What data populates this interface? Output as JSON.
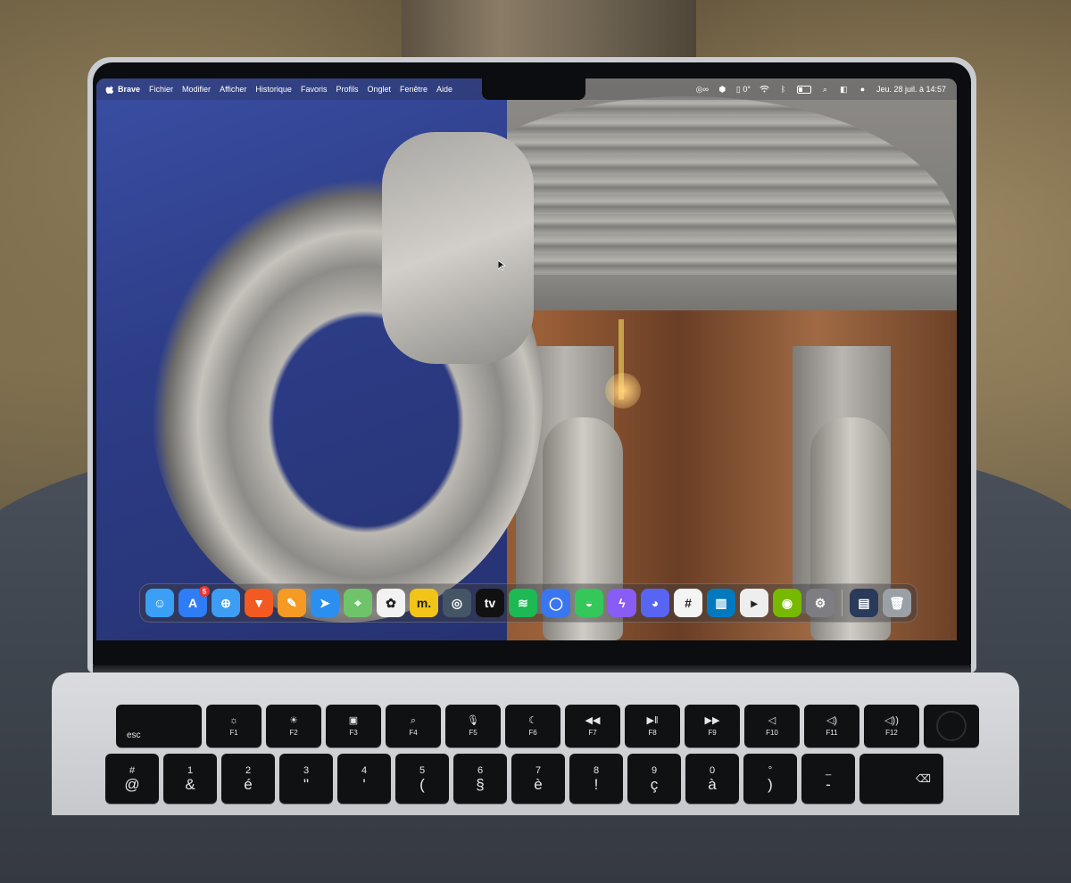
{
  "menubar": {
    "app_name": "Brave",
    "items": [
      "Fichier",
      "Modifier",
      "Afficher",
      "Historique",
      "Favoris",
      "Profils",
      "Onglet",
      "Fenêtre",
      "Aide"
    ],
    "status": {
      "vpn_text": "∞",
      "temp_text": "0°",
      "datetime": "Jeu. 28 juil. à 14:57"
    }
  },
  "dock": {
    "appstore_badge": "5",
    "apps": [
      {
        "name": "finder-icon",
        "glyph": "☺",
        "color": "#3aa0f5"
      },
      {
        "name": "app-store-icon",
        "glyph": "A",
        "color": "#2f7df6"
      },
      {
        "name": "safari-icon",
        "glyph": "⊕",
        "color": "#3d9df2"
      },
      {
        "name": "brave-icon",
        "glyph": "▼",
        "color": "#f25a22"
      },
      {
        "name": "pages-icon",
        "glyph": "✎",
        "color": "#f59a23"
      },
      {
        "name": "spark-icon",
        "glyph": "➤",
        "color": "#2b8ff0"
      },
      {
        "name": "maps-icon",
        "glyph": "⌖",
        "color": "#6fc46a"
      },
      {
        "name": "photos-icon",
        "glyph": "✿",
        "color": "#f2f2f2"
      },
      {
        "name": "metaview-icon",
        "glyph": "m.",
        "color": "#f2c418"
      },
      {
        "name": "quicktime-icon",
        "glyph": "◎",
        "color": "#445566"
      },
      {
        "name": "apple-tv-icon",
        "glyph": "tv",
        "color": "#111111"
      },
      {
        "name": "spotify-icon",
        "glyph": "≋",
        "color": "#1db954"
      },
      {
        "name": "signal-icon",
        "glyph": "◯",
        "color": "#3a76f0"
      },
      {
        "name": "messages-icon",
        "glyph": "◒",
        "color": "#34c759"
      },
      {
        "name": "messenger-icon",
        "glyph": "ϟ",
        "color": "#8a5cf6"
      },
      {
        "name": "discord-icon",
        "glyph": "◕",
        "color": "#5865f2"
      },
      {
        "name": "slack-icon",
        "glyph": "#",
        "color": "#f4f4f4"
      },
      {
        "name": "trello-icon",
        "glyph": "▥",
        "color": "#0079bf"
      },
      {
        "name": "plex-icon",
        "glyph": "▸",
        "color": "#eeeeee"
      },
      {
        "name": "nvidia-icon",
        "glyph": "◉",
        "color": "#76b900"
      },
      {
        "name": "system-settings-icon",
        "glyph": "⚙",
        "color": "#7d7d82"
      }
    ],
    "right_items": [
      {
        "name": "downloads-stack-icon",
        "glyph": "▤",
        "color": "#2a3a5a"
      },
      {
        "name": "trash-icon",
        "glyph": "🗑",
        "color": "#9aa0a6"
      }
    ]
  },
  "keyboard": {
    "function_row": [
      {
        "icon": "",
        "label": "esc"
      },
      {
        "icon": "☼",
        "label": "F1"
      },
      {
        "icon": "☀",
        "label": "F2"
      },
      {
        "icon": "▣",
        "label": "F3"
      },
      {
        "icon": "⌕",
        "label": "F4"
      },
      {
        "icon": "🎙",
        "label": "F5"
      },
      {
        "icon": "☾",
        "label": "F6"
      },
      {
        "icon": "◀◀",
        "label": "F7"
      },
      {
        "icon": "▶‖",
        "label": "F8"
      },
      {
        "icon": "▶▶",
        "label": "F9"
      },
      {
        "icon": "◁",
        "label": "F10"
      },
      {
        "icon": "◁)",
        "label": "F11"
      },
      {
        "icon": "◁))",
        "label": "F12"
      }
    ],
    "number_row": [
      {
        "top": "#",
        "bottom": "@"
      },
      {
        "top": "1",
        "bottom": "&"
      },
      {
        "top": "2",
        "bottom": "é"
      },
      {
        "top": "3",
        "bottom": "\""
      },
      {
        "top": "4",
        "bottom": "'"
      },
      {
        "top": "5",
        "bottom": "("
      },
      {
        "top": "6",
        "bottom": "§"
      },
      {
        "top": "7",
        "bottom": "è"
      },
      {
        "top": "8",
        "bottom": "!"
      },
      {
        "top": "9",
        "bottom": "ç"
      },
      {
        "top": "0",
        "bottom": "à"
      },
      {
        "top": "°",
        "bottom": ")"
      },
      {
        "top": "_",
        "bottom": "-"
      },
      {
        "top": "",
        "bottom": "⌫"
      }
    ]
  }
}
